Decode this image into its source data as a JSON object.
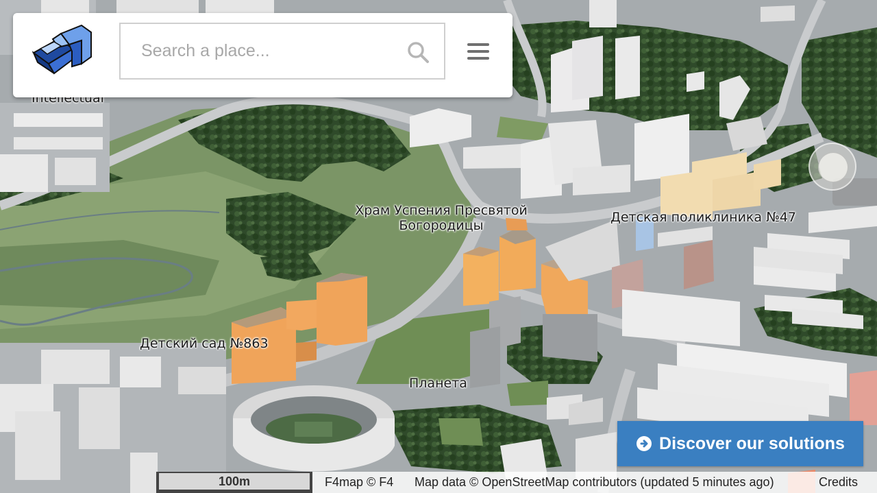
{
  "header": {
    "search_placeholder": "Search a place...",
    "logo": "f4-cube-logo",
    "search_icon": "search-icon",
    "menu_icon": "hamburger-menu-icon"
  },
  "map": {
    "labels": {
      "temple": [
        "Храм Успения Пресвятой",
        "Богородицы"
      ],
      "clinic": "Детская поликлиника №47",
      "kindergarten": "Детский сад №863",
      "planeta": "Планета",
      "partial_top_left": "Intellectual"
    }
  },
  "cta": {
    "label": "Discover our solutions",
    "icon": "arrow-circle-right-icon",
    "color": "#3a7fc1"
  },
  "footer": {
    "scale": "100m",
    "f4map_credit": "F4map © F4",
    "osm_credit": "Map data © OpenStreetMap contributors (updated 5 minutes ago)",
    "credits_link": "Credits"
  },
  "controls": {
    "compass_icon": "compass-icon"
  }
}
